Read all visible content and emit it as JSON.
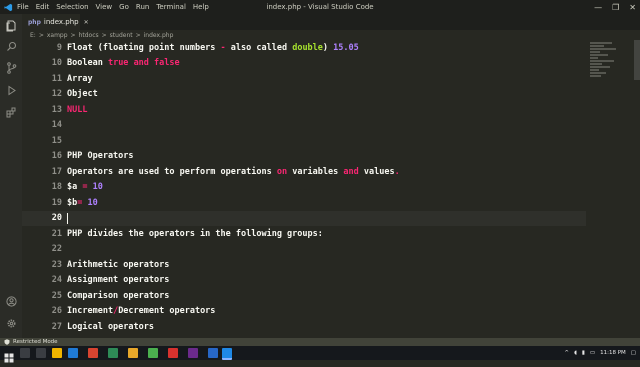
{
  "window": {
    "title": "index.php - Visual Studio Code",
    "menu": [
      "File",
      "Edit",
      "Selection",
      "View",
      "Go",
      "Run",
      "Terminal",
      "Help"
    ],
    "controls": [
      "—",
      "❐",
      "✕"
    ]
  },
  "activity_bar": [
    "files-icon",
    "search-icon",
    "source-control-icon",
    "run-debug-icon",
    "extensions-icon"
  ],
  "activity_bottom": [
    "account-icon",
    "settings-gear-icon"
  ],
  "tab": {
    "icon": "php",
    "label": "index.php",
    "close": "✕"
  },
  "breadcrumb": [
    "E:",
    ">",
    "xampp",
    ">",
    "htdocs",
    ">",
    "student",
    ">",
    "index.php"
  ],
  "editor": {
    "lines": [
      {
        "num": "9",
        "segs": [
          [
            "t",
            "Float "
          ],
          [
            "t",
            "(floating point numbers "
          ],
          [
            "k",
            "-"
          ],
          [
            "t",
            " also called "
          ],
          [
            "g",
            "double"
          ],
          [
            "t",
            ") "
          ],
          [
            "n",
            "15.05"
          ]
        ]
      },
      {
        "num": "10",
        "segs": [
          [
            "t",
            "Boolean "
          ],
          [
            "k",
            "true"
          ],
          [
            "t",
            " "
          ],
          [
            "k",
            "and"
          ],
          [
            "t",
            " "
          ],
          [
            "k",
            "false"
          ]
        ]
      },
      {
        "num": "11",
        "segs": [
          [
            "t",
            "Array"
          ]
        ]
      },
      {
        "num": "12",
        "segs": [
          [
            "t",
            "Object"
          ]
        ]
      },
      {
        "num": "13",
        "segs": [
          [
            "k",
            "NULL"
          ]
        ]
      },
      {
        "num": "14",
        "segs": []
      },
      {
        "num": "15",
        "segs": []
      },
      {
        "num": "16",
        "segs": [
          [
            "t",
            "PHP Operators"
          ]
        ]
      },
      {
        "num": "17",
        "segs": [
          [
            "t",
            "Operators are used to perform operations "
          ],
          [
            "k",
            "on"
          ],
          [
            "t",
            " variables "
          ],
          [
            "k",
            "and"
          ],
          [
            "t",
            " values"
          ],
          [
            "k",
            "."
          ]
        ]
      },
      {
        "num": "18",
        "segs": [
          [
            "t",
            "$a "
          ],
          [
            "k",
            "="
          ],
          [
            "t",
            " "
          ],
          [
            "n",
            "10"
          ]
        ]
      },
      {
        "num": "19",
        "segs": [
          [
            "t",
            "$b"
          ],
          [
            "k",
            "="
          ],
          [
            "t",
            " "
          ],
          [
            "n",
            "10"
          ]
        ]
      },
      {
        "num": "20",
        "segs": [],
        "active": true
      },
      {
        "num": "21",
        "segs": [
          [
            "t",
            "PHP divides the operators in the following groups:"
          ]
        ]
      },
      {
        "num": "22",
        "segs": []
      },
      {
        "num": "23",
        "segs": [
          [
            "t",
            "Arithmetic operators"
          ]
        ]
      },
      {
        "num": "24",
        "segs": [
          [
            "t",
            "Assignment operators"
          ]
        ]
      },
      {
        "num": "25",
        "segs": [
          [
            "t",
            "Comparison operators"
          ]
        ]
      },
      {
        "num": "26",
        "segs": [
          [
            "t",
            "Increment"
          ],
          [
            "k",
            "/"
          ],
          [
            "t",
            "Decrement operators"
          ]
        ]
      },
      {
        "num": "27",
        "segs": [
          [
            "t",
            "Logical operators"
          ]
        ]
      }
    ]
  },
  "status": {
    "mode_label": "Restricted Mode"
  },
  "taskbar": {
    "time": "11:18 PM",
    "tray_icons": [
      "chevron-up-icon",
      "speaker-icon",
      "network-icon",
      "battery-icon"
    ]
  },
  "colors": {
    "keyword": "#f92672",
    "number": "#ae81ff",
    "function": "#a6e22e",
    "text": "#f8f8f2",
    "background": "#272822"
  }
}
